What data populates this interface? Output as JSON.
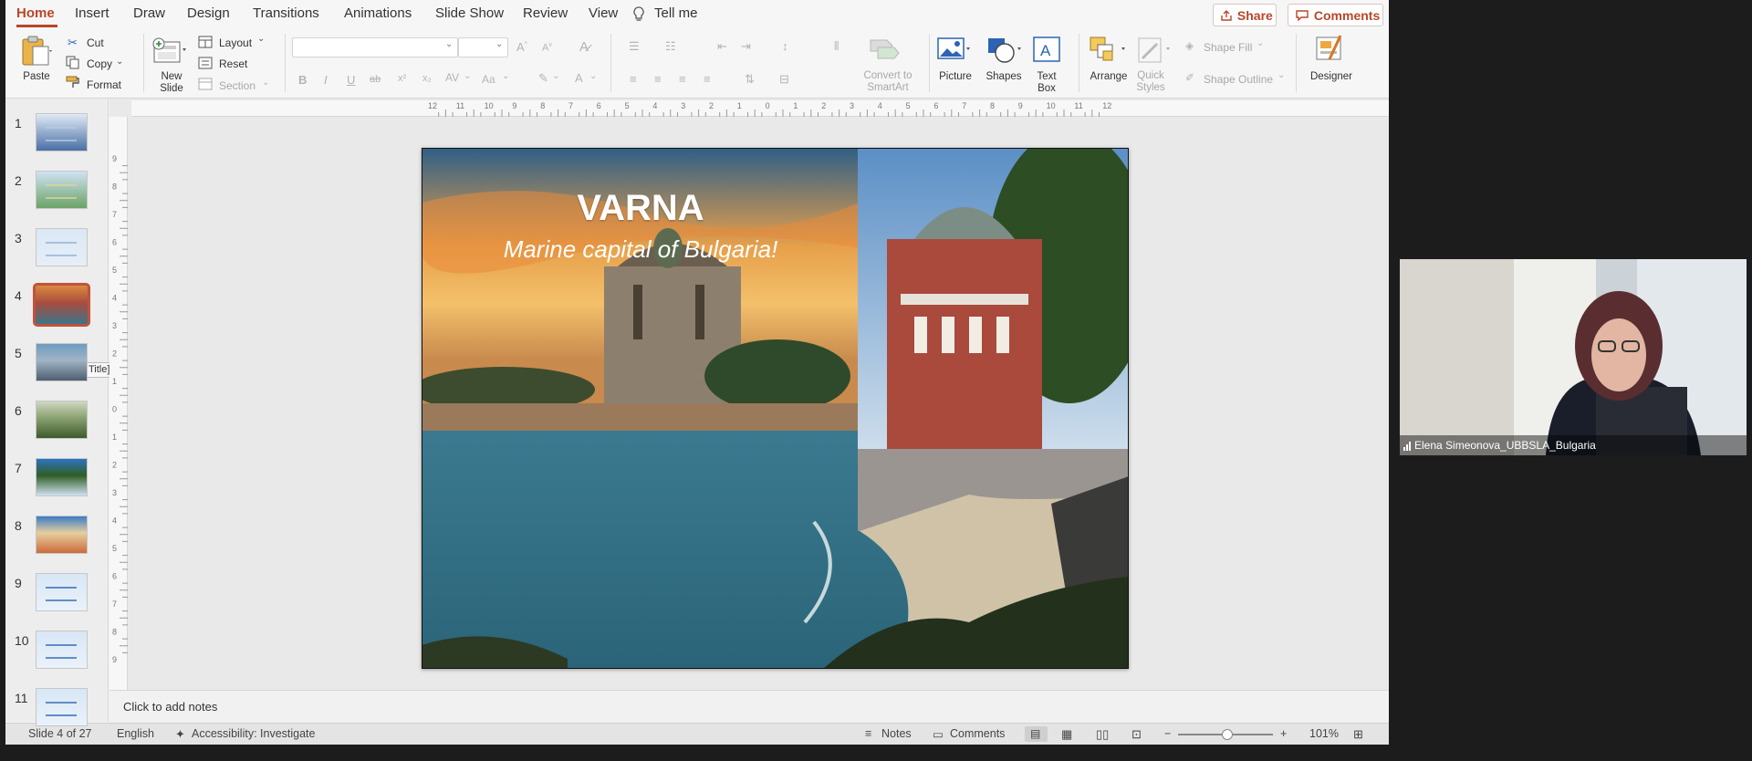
{
  "menu": {
    "tabs": [
      "Home",
      "Insert",
      "Draw",
      "Design",
      "Transitions",
      "Animations",
      "Slide Show",
      "Review",
      "View"
    ],
    "active": "Home",
    "tell_me": "Tell me",
    "share": "Share",
    "comments": "Comments"
  },
  "ribbon": {
    "paste": "Paste",
    "cut": "Cut",
    "copy": "Copy",
    "format": "Format",
    "new_slide": "New\nSlide",
    "layout": "Layout",
    "reset": "Reset",
    "section": "Section",
    "bold": "B",
    "italic": "I",
    "underline": "U",
    "strike": "ab",
    "superscript": "x²",
    "subscript": "x₂",
    "char_spacing": "AV",
    "change_case": "Aa",
    "font_color": "A",
    "convert_smartart": "Convert to\nSmartArt",
    "picture": "Picture",
    "shapes": "Shapes",
    "text_box": "Text\nBox",
    "arrange": "Arrange",
    "quick_styles": "Quick\nStyles",
    "shape_fill": "Shape Fill",
    "shape_outline": "Shape Outline",
    "designer": "Designer"
  },
  "ruler": {
    "h": [
      "12",
      "11",
      "10",
      "9",
      "8",
      "7",
      "6",
      "5",
      "4",
      "3",
      "2",
      "1",
      "0",
      "1",
      "2",
      "3",
      "4",
      "5",
      "6",
      "7",
      "8",
      "9",
      "10",
      "11",
      "12"
    ],
    "v": [
      "9",
      "8",
      "7",
      "6",
      "5",
      "4",
      "3",
      "2",
      "1",
      "0",
      "1",
      "2",
      "3",
      "4",
      "5",
      "6",
      "7",
      "8",
      "9"
    ]
  },
  "thumbnails": [
    {
      "num": "1",
      "style": "title"
    },
    {
      "num": "2",
      "style": "map"
    },
    {
      "num": "3",
      "style": "text-map"
    },
    {
      "num": "4",
      "style": "photo-varna",
      "selected": true
    },
    {
      "num": "5",
      "style": "photo-coast"
    },
    {
      "num": "6",
      "style": "photo-park"
    },
    {
      "num": "7",
      "style": "photo-sea"
    },
    {
      "num": "8",
      "style": "photo-beach"
    },
    {
      "num": "9",
      "style": "text-blue"
    },
    {
      "num": "10",
      "style": "text-blue"
    },
    {
      "num": "11",
      "style": "text-blue"
    }
  ],
  "tooltip": "[No Title]",
  "slide": {
    "title": "VARNA",
    "subtitle": "Marine capital of Bulgaria!"
  },
  "notes_placeholder": "Click to add notes",
  "status": {
    "slide_info": "Slide 4 of 27",
    "language": "English",
    "accessibility": "Accessibility: Investigate",
    "notes": "Notes",
    "comments": "Comments",
    "zoom": "101%",
    "zoom_level": 0.52
  },
  "video": {
    "name": "Elena Simeonova_UBBSLA_Bulgaria"
  },
  "colors": {
    "accent": "#b7472a"
  }
}
